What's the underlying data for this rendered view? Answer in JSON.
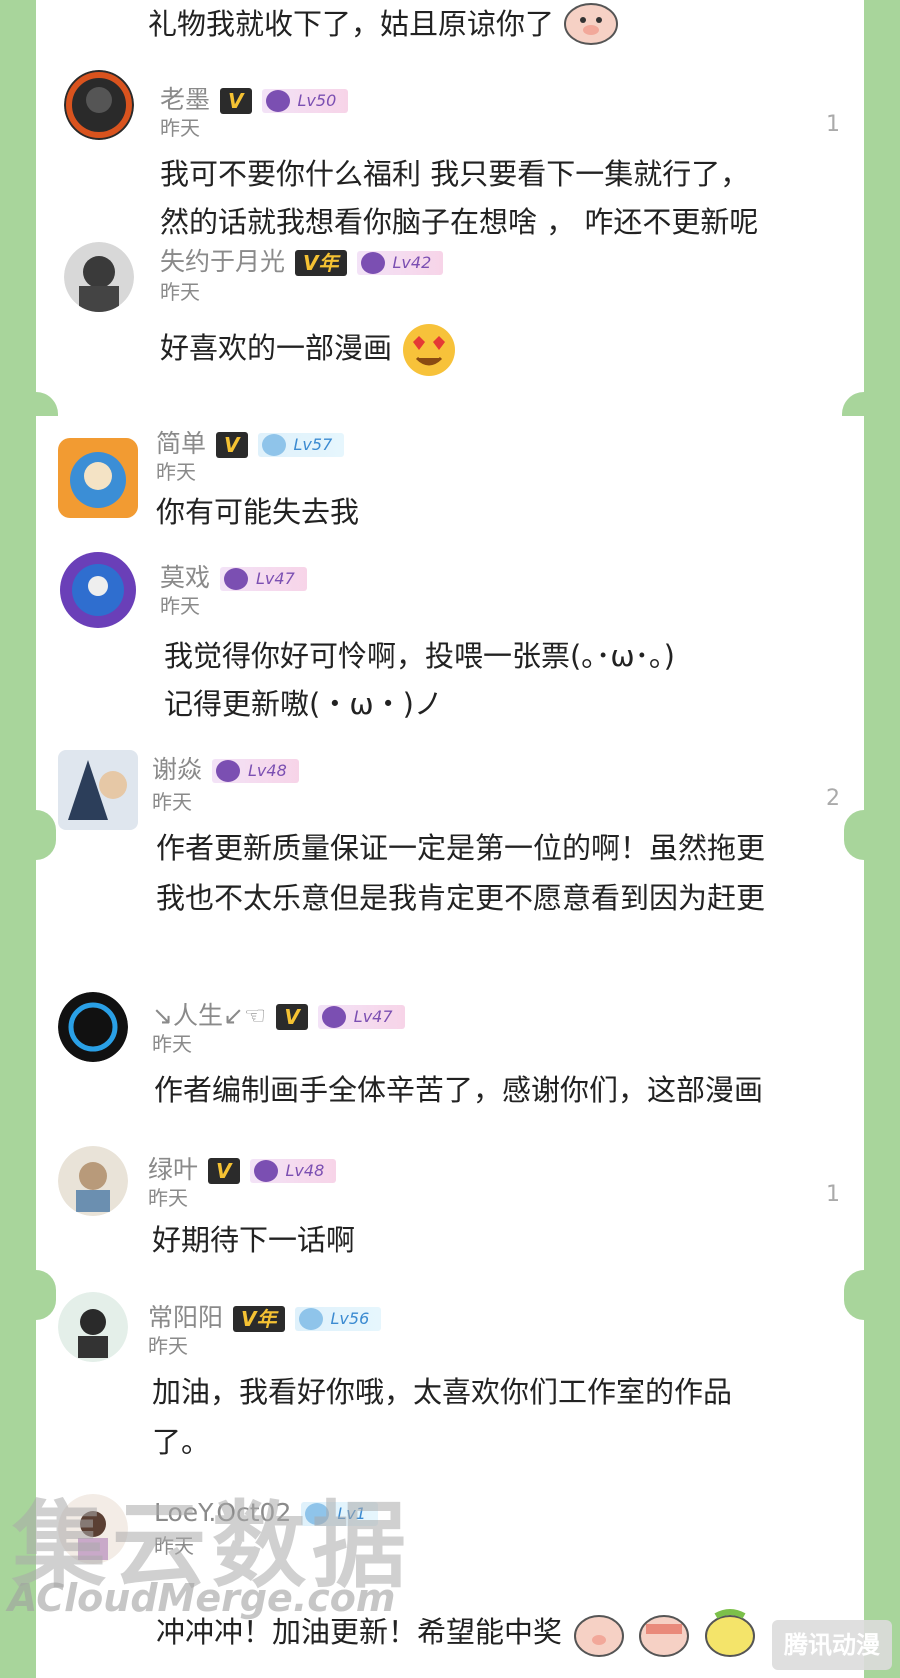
{
  "comments": [
    {
      "text": "礼物我就收下了，姑且原谅你了"
    },
    {
      "name": "老墨",
      "vip": "V",
      "level": "Lv50",
      "time": "昨天",
      "likes": "1",
      "line1": "我可不要你什么福利 我只要看下一集就行了，",
      "line2": "然的话就我想看你脑子在想啥 ， 咋还不更新呢"
    },
    {
      "name": "失约于月光",
      "vip": "V年",
      "level": "Lv42",
      "time": "昨天",
      "line1": "好喜欢的一部漫画"
    },
    {
      "name": "简单",
      "vip": "V",
      "level": "Lv57",
      "time": "昨天",
      "line1": "你有可能失去我"
    },
    {
      "name": "莫戏",
      "level": "Lv47",
      "time": "昨天",
      "line1": "我觉得你好可怜啊，投喂一张票(｡･ω･｡)",
      "line2": "记得更新嗷(・ω・)ノ"
    },
    {
      "name": "谢焱",
      "level": "Lv48",
      "time": "昨天",
      "likes": "2",
      "line1": "作者更新质量保证一定是第一位的啊！虽然拖更",
      "line2": "我也不太乐意但是我肯定更不愿意看到因为赶更"
    },
    {
      "name": "↘人生↙☜",
      "vip": "V",
      "level": "Lv47",
      "time": "昨天",
      "line1": "作者编制画手全体辛苦了，感谢你们，这部漫画"
    },
    {
      "name": "绿叶",
      "vip": "V",
      "level": "Lv48",
      "time": "昨天",
      "likes": "1",
      "line1": "好期待下一话啊"
    },
    {
      "name": "常阳阳",
      "vip": "V年",
      "level": "Lv56",
      "time": "昨天",
      "line1": "加油，我看好你哦，太喜欢你们工作室的作品",
      "line2": "了。"
    },
    {
      "name": "LoeY.Oct02",
      "level": "Lv1",
      "time": "昨天",
      "line1": "冲冲冲！加油更新！希望能中奖"
    }
  ],
  "watermark": {
    "main": "集云数据",
    "sub": "ACloudMerge.com"
  },
  "logo": "腾讯动漫"
}
